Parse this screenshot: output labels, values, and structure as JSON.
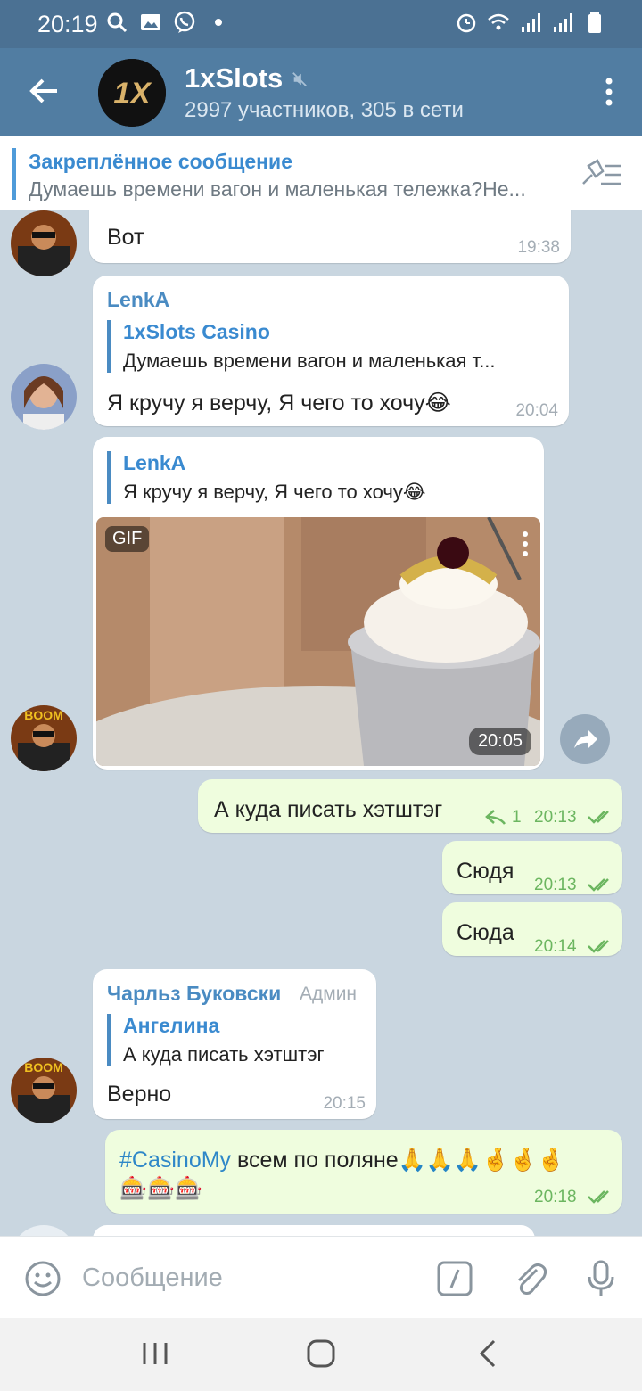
{
  "status_bar": {
    "time": "20:19"
  },
  "header": {
    "title": "1xSlots",
    "subtitle": "2997 участников, 305 в сети",
    "logo_text": "1X"
  },
  "pinned": {
    "title": "Закреплённое сообщение",
    "text": "Думаешь времени вагон и маленькая тележка?Не..."
  },
  "messages": [
    {
      "text": "Вот",
      "time": "19:38"
    },
    {
      "sender": "LenkA",
      "reply_name": "1xSlots Casino",
      "reply_text": "Думаешь времени вагон и маленькая т...",
      "text": "Я кручу я верчу, Я чего то хочу😂",
      "time": "20:04"
    },
    {
      "reply_name": "LenkA",
      "reply_text": "Я кручу я верчу, Я чего то хочу😂",
      "gif_label": "GIF",
      "gif_time": "20:05"
    },
    {
      "text": "А куда писать хэтштэг",
      "reply_count": "1",
      "time": "20:13"
    },
    {
      "text": "Сюдя",
      "time": "20:13"
    },
    {
      "text": "Сюда",
      "time": "20:14"
    },
    {
      "sender": "Чарльз Буковски",
      "badge": "Админ",
      "reply_name": "Ангелина",
      "reply_text": "А куда писать хэтштэг",
      "text": "Верно",
      "time": "20:15"
    },
    {
      "hashtag": "#CasinoMy",
      "text": " всем по поляне🙏🙏🙏🤞🤞🤞",
      "emoji_line": "🎰🎰🎰",
      "time": "20:18"
    }
  ],
  "input": {
    "placeholder": "Сообщение"
  },
  "colors": {
    "header": "#517da2",
    "status_bar": "#4b7193",
    "accent": "#4a8bc2",
    "outgoing": "#effdde"
  }
}
